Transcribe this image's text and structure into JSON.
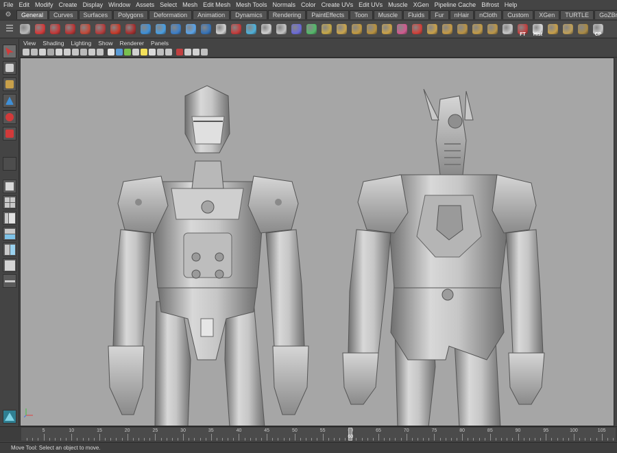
{
  "menubar": [
    "File",
    "Edit",
    "Modify",
    "Create",
    "Display",
    "Window",
    "Assets",
    "Select",
    "Mesh",
    "Edit Mesh",
    "Mesh Tools",
    "Normals",
    "Color",
    "Create UVs",
    "Edit UVs",
    "Muscle",
    "XGen",
    "Pipeline Cache",
    "Bifrost",
    "Help"
  ],
  "shelf_tabs": [
    "General",
    "Curves",
    "Surfaces",
    "Polygons",
    "Deformation",
    "Animation",
    "Dynamics",
    "Rendering",
    "PaintEffects",
    "Toon",
    "Muscle",
    "Fluids",
    "Fur",
    "nHair",
    "nCloth",
    "Custom",
    "XGen",
    "TURTLE",
    "GoZBrush"
  ],
  "active_shelf_tab": "General",
  "shelf_icons": [
    {
      "name": "film-camera-icon",
      "color": "#b9b9b9"
    },
    {
      "name": "help-question-icon",
      "color": "#d23a3a"
    },
    {
      "name": "render-teapot-icon",
      "color": "#c23838"
    },
    {
      "name": "render-ipr-icon",
      "color": "#b83434"
    },
    {
      "name": "render-region-icon",
      "color": "#c14a3a"
    },
    {
      "name": "render-settings-icon",
      "color": "#b43c3c"
    },
    {
      "name": "hypershade-icon",
      "color": "#c63a2a"
    },
    {
      "name": "material-red-icon",
      "color": "#a52f2f"
    },
    {
      "name": "sphere-blue-icon",
      "color": "#3f8fd6"
    },
    {
      "name": "joint-tool-icon",
      "color": "#4a9ee0"
    },
    {
      "name": "ik-handle-icon",
      "color": "#3d7fc8"
    },
    {
      "name": "skin-bind-icon",
      "color": "#5aa2e6"
    },
    {
      "name": "paint-weights-icon",
      "color": "#3673b8"
    },
    {
      "name": "graph-editor-icon",
      "color": "#d0d0d0"
    },
    {
      "name": "node-editor-icon",
      "color": "#c43c3c"
    },
    {
      "name": "uv-editor-icon",
      "color": "#4fb0d9"
    },
    {
      "name": "paint-tool-icon",
      "color": "#cfcfcf"
    },
    {
      "name": "sculpt-icon",
      "color": "#c4c4c4"
    },
    {
      "name": "lattice-icon",
      "color": "#6b6bd6"
    },
    {
      "name": "cluster-icon",
      "color": "#54b86a"
    },
    {
      "name": "plane-icon",
      "color": "#c5a84a"
    },
    {
      "name": "poly-plane-icon",
      "color": "#caa54e"
    },
    {
      "name": "checker-icon",
      "color": "#c29a42"
    },
    {
      "name": "grid-plane-icon",
      "color": "#b8913f"
    },
    {
      "name": "mesh-tile-icon",
      "color": "#caa24a"
    },
    {
      "name": "pyramid-icon",
      "color": "#d05b8f"
    },
    {
      "name": "cone-red-icon",
      "color": "#d0413a"
    },
    {
      "name": "cube-gold-icon",
      "color": "#c8a04a"
    },
    {
      "name": "cube-split-icon",
      "color": "#c49a47"
    },
    {
      "name": "slab-icon",
      "color": "#b99244"
    },
    {
      "name": "cube-stack-icon",
      "color": "#c19b49"
    },
    {
      "name": "panel-icon",
      "color": "#bb9648"
    },
    {
      "name": "wrench-icon",
      "color": "#c7c7c7"
    },
    {
      "name": "freeze-transform-icon",
      "color": "#c04040",
      "label": "FT"
    },
    {
      "name": "history-icon",
      "color": "#d8d8d8",
      "label": "Hist"
    },
    {
      "name": "uv-layout-icon",
      "color": "#c79f4a"
    },
    {
      "name": "cube-flat-icon",
      "color": "#bfa05a"
    },
    {
      "name": "slab-dark-icon",
      "color": "#a98a45"
    },
    {
      "name": "center-pivot-icon",
      "color": "#c7c7c7",
      "label": "CP"
    }
  ],
  "toolbox": {
    "tools": [
      {
        "name": "select-tool-icon",
        "color": "#d23a3a",
        "selected": true
      },
      {
        "name": "lasso-tool-icon",
        "color": "#cfcfcf"
      },
      {
        "name": "paint-select-tool-icon",
        "color": "#c8a04a"
      },
      {
        "name": "move-tool-icon",
        "color": "#3f8fd6"
      },
      {
        "name": "rotate-tool-icon",
        "color": "#d23a3a"
      },
      {
        "name": "scale-tool-icon",
        "color": "#d23a3a"
      }
    ]
  },
  "panel": {
    "menu": [
      "View",
      "Shading",
      "Lighting",
      "Show",
      "Renderer",
      "Panels"
    ],
    "toolbar_icons": [
      "camera-select-icon",
      "camera-attributes-icon",
      "bookmark-icon",
      "image-plane-icon",
      "grid-toggle-icon",
      "film-gate-icon",
      "resolution-gate-icon",
      "gate-mask-icon",
      "field-chart-icon",
      "safe-action-icon",
      "wireframe-icon",
      "smooth-shade-icon",
      "wireframe-on-shaded-icon",
      "textured-icon",
      "use-all-lights-icon",
      "shadows-icon",
      "ambient-occlusion-icon",
      "motion-blur-icon",
      "isolate-select-icon",
      "xray-icon",
      "xray-joints-icon",
      "backface-icon"
    ]
  },
  "viewport": {
    "background": "#a6a6a6",
    "objects": [
      "genji-model-front",
      "genji-model-back"
    ]
  },
  "timeslider": {
    "start": 1,
    "labels": [
      5,
      10,
      15,
      20,
      25,
      30,
      35,
      40,
      45,
      50,
      55,
      60,
      65,
      70,
      75,
      80,
      85,
      90,
      95,
      100,
      105
    ],
    "current_frame": 60,
    "current_label": "60"
  },
  "helpline": "Move Tool: Select an object to move."
}
